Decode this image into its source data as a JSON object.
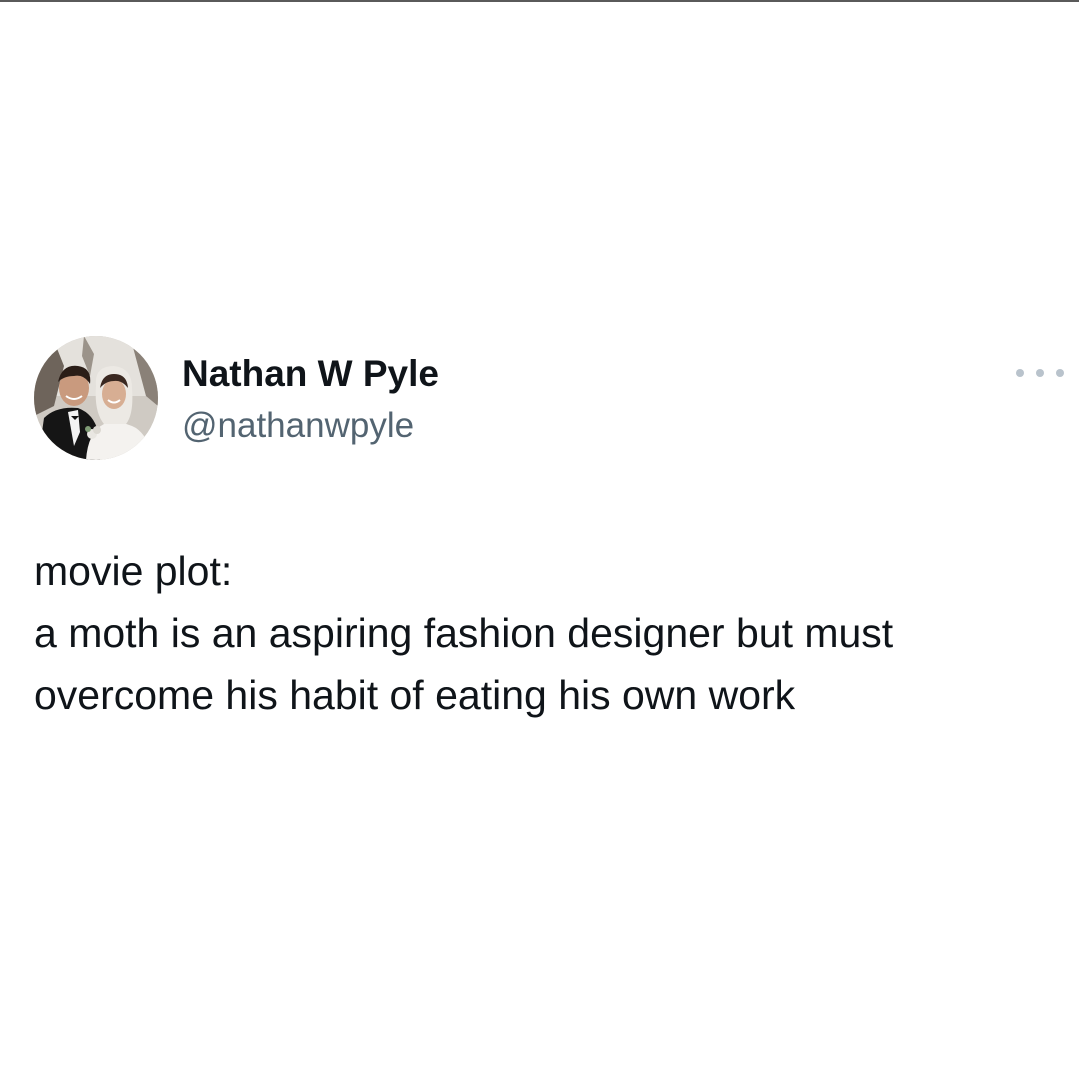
{
  "author": {
    "display_name": "Nathan W Pyle",
    "handle": "@nathanwpyle",
    "avatar": "profile-photo"
  },
  "tweet": {
    "lines": [
      "movie plot:",
      "a moth is an aspiring fashion designer but must",
      "overcome his habit of eating his own work"
    ]
  },
  "controls": {
    "more_icon": "more-horizontal-icon"
  },
  "colors": {
    "text": "#0f1419",
    "secondary_text": "#536471",
    "icon_muted": "#b9c3cc",
    "background": "#ffffff"
  }
}
